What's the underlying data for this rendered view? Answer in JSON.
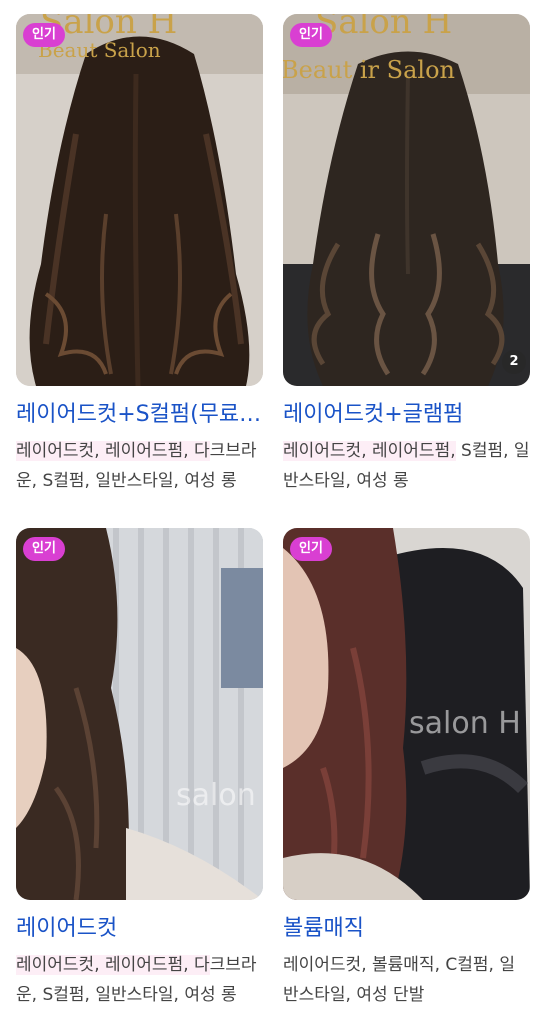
{
  "cards": [
    {
      "badge": "인기",
      "title": "레이어드컷+S컬펌(무료업그레이드)",
      "tags_highlight": "레이어드컷, 레이어드펌, 다",
      "tags_rest": "크브라운, S컬펌, 일반스타일, 여성 롱",
      "sign_top": "Salon H",
      "sign_bottom": "Beaut  Salon"
    },
    {
      "badge": "인기",
      "title": "레이어드컷+글램펌",
      "tags_highlight": "레이어드컷, 레이어드펌,",
      "tags_rest": " S컬펌, 일반스타일, 여성 롱",
      "image_count": "2",
      "sign_top": "Salon H",
      "sign_bottom": "Beaut   ir Salon"
    },
    {
      "badge": "인기",
      "title": "레이어드컷",
      "tags_highlight": "레이어드컷, 레이어드펌, 다",
      "tags_rest": "크브라운, S컬펌, 일반스타일, 여성 롱",
      "watermark": "salon"
    },
    {
      "badge": "인기",
      "title": "볼륨매직",
      "tags_highlight": "",
      "tags_rest": "레이어드컷, 볼륨매직, C컬펌, 일반스타일, 여성 단발",
      "watermark": "salon H"
    }
  ],
  "colors": {
    "badge": "#d93fd2",
    "title": "#1a53c7",
    "highlight": "#fdeef6"
  }
}
